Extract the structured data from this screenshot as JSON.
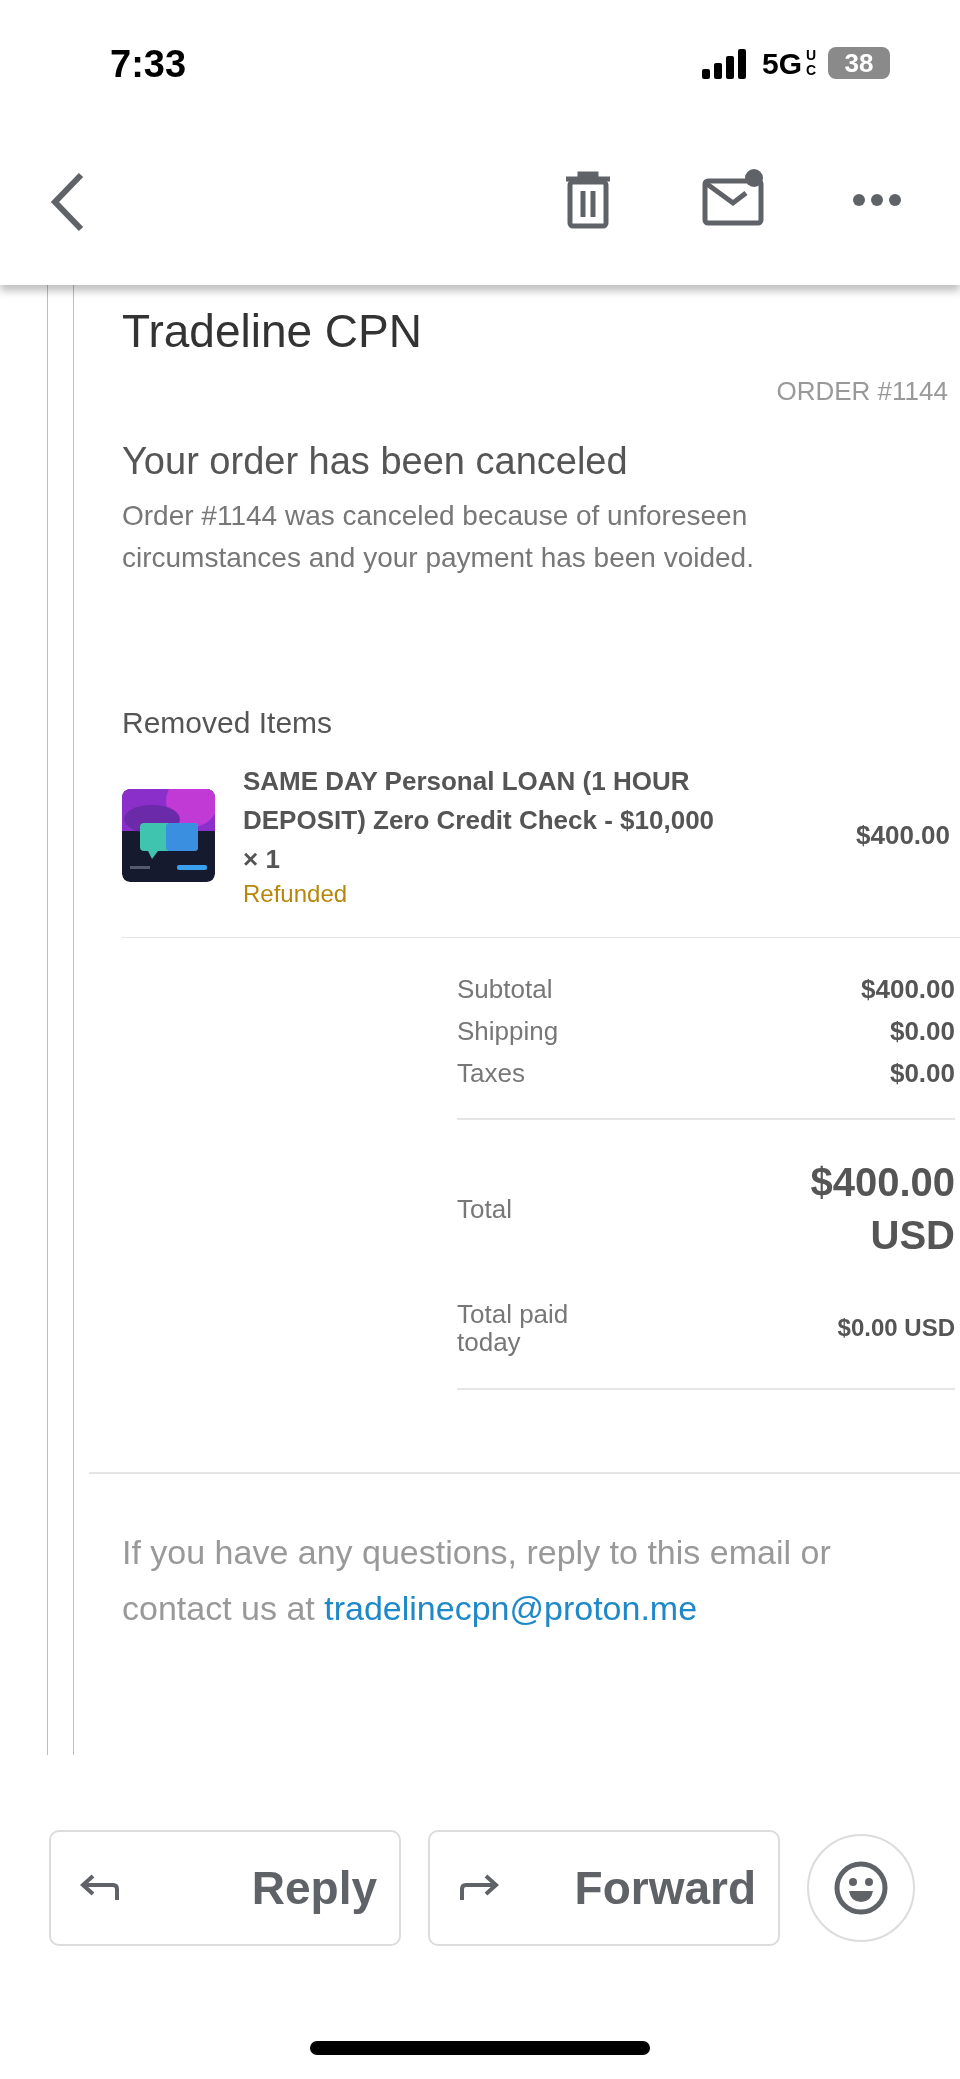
{
  "status_bar": {
    "time": "7:33",
    "network": "5G",
    "network_suffix": "UC",
    "battery": "38"
  },
  "email": {
    "store_name": "Tradeline CPN",
    "order_number": "ORDER #1144",
    "heading": "Your order has been canceled",
    "message": "Order #1144 was canceled because of unforeseen circumstances and your payment has been voided.",
    "removed_heading": "Removed Items",
    "items": [
      {
        "title": "SAME DAY Personal LOAN (1 HOUR DEPOSIT) Zero Credit Check - $10,000 × 1",
        "status": "Refunded",
        "price": "$400.00"
      }
    ],
    "summary": [
      {
        "label": "Subtotal",
        "value": "$400.00"
      },
      {
        "label": "Shipping",
        "value": "$0.00"
      },
      {
        "label": "Taxes",
        "value": "$0.00"
      }
    ],
    "total": {
      "label": "Total",
      "value": "$400.00 USD"
    },
    "total_paid": {
      "label": "Total paid today",
      "value": "$0.00 USD"
    },
    "footer": {
      "text": "If you have any questions, reply to this email or contact us at",
      "link": "tradelinecpn@proton.me"
    }
  },
  "actions": [
    {
      "kind": "reply",
      "label": "Reply"
    },
    {
      "kind": "forward",
      "label": "Forward"
    }
  ]
}
